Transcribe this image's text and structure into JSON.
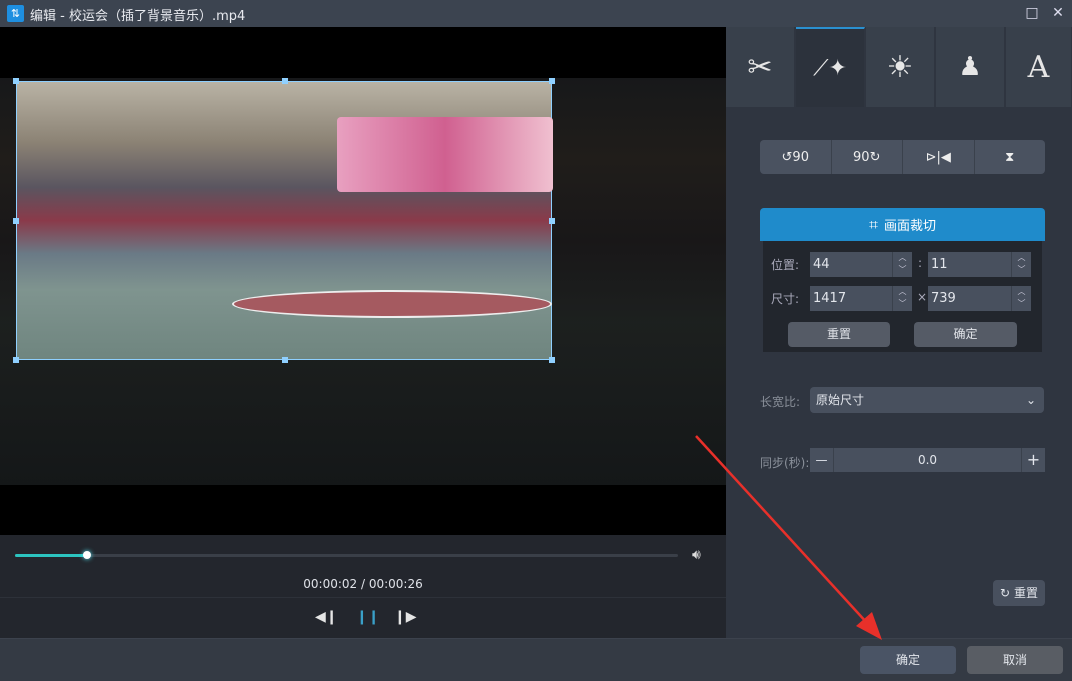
{
  "window": {
    "title": "编辑 - 校运会（插了背景音乐）.mp4",
    "app_icon": "swap-icon",
    "maximize": "□",
    "close": "✕"
  },
  "player": {
    "time": "00:00:02 / 00:00:26",
    "progress": 0.108
  },
  "tabs": [
    {
      "name": "cut",
      "glyph": "✂"
    },
    {
      "name": "magic-wand",
      "glyph": "🪄"
    },
    {
      "name": "brightness",
      "glyph": "◐"
    },
    {
      "name": "stamp",
      "glyph": "⊥"
    },
    {
      "name": "text",
      "glyph": "A"
    }
  ],
  "rotate": {
    "rotate_left": "↺90",
    "rotate_right": "90↻",
    "flip_h": "⊳|◀",
    "flip_v": "⧗"
  },
  "crop": {
    "title": "画面裁切",
    "position_label": "位置:",
    "x": "44",
    "y": "11",
    "size_label": "尺寸:",
    "width": "1417",
    "height": "739",
    "sep_pos": ":",
    "sep_size": "×",
    "reset": "重置",
    "confirm": "确定"
  },
  "aspect": {
    "label": "长宽比:",
    "value": "原始尺寸"
  },
  "sync": {
    "label": "同步(秒):",
    "value": "0.0",
    "minus": "—",
    "plus": "+"
  },
  "reset_all": "重置",
  "footer": {
    "ok": "确定",
    "cancel": "取消"
  }
}
